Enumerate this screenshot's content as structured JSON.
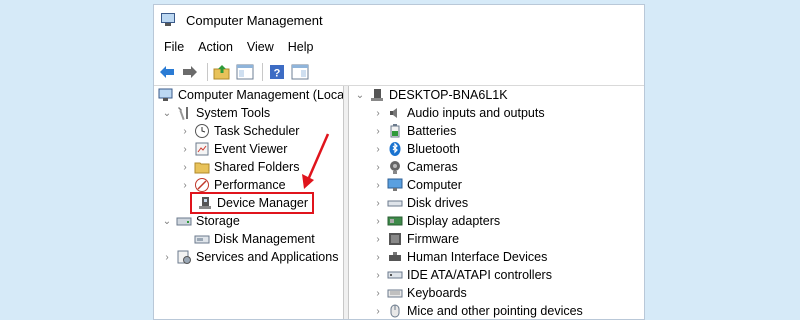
{
  "window": {
    "title": "Computer Management"
  },
  "menu": [
    "File",
    "Action",
    "View",
    "Help"
  ],
  "toolbar": {
    "icons": [
      "back-arrow-icon",
      "forward-arrow-icon",
      "up-folder-icon",
      "show-hide-tree-icon",
      "help-icon",
      "properties-icon"
    ]
  },
  "tree": {
    "root": "Computer Management (Local",
    "system_tools": "System Tools",
    "task_scheduler": "Task Scheduler",
    "event_viewer": "Event Viewer",
    "shared_folders": "Shared Folders",
    "performance": "Performance",
    "device_manager": "Device Manager",
    "storage": "Storage",
    "disk_management": "Disk Management",
    "services": "Services and Applications"
  },
  "devices": {
    "computer_name": "DESKTOP-BNA6L1K",
    "items": [
      "Audio inputs and outputs",
      "Batteries",
      "Bluetooth",
      "Cameras",
      "Computer",
      "Disk drives",
      "Display adapters",
      "Firmware",
      "Human Interface Devices",
      "IDE ATA/ATAPI controllers",
      "Keyboards",
      "Mice and other pointing devices"
    ]
  },
  "colors": {
    "highlight": "#e0141c",
    "background": "#d6eaf8",
    "accent": "#1a73d0"
  }
}
